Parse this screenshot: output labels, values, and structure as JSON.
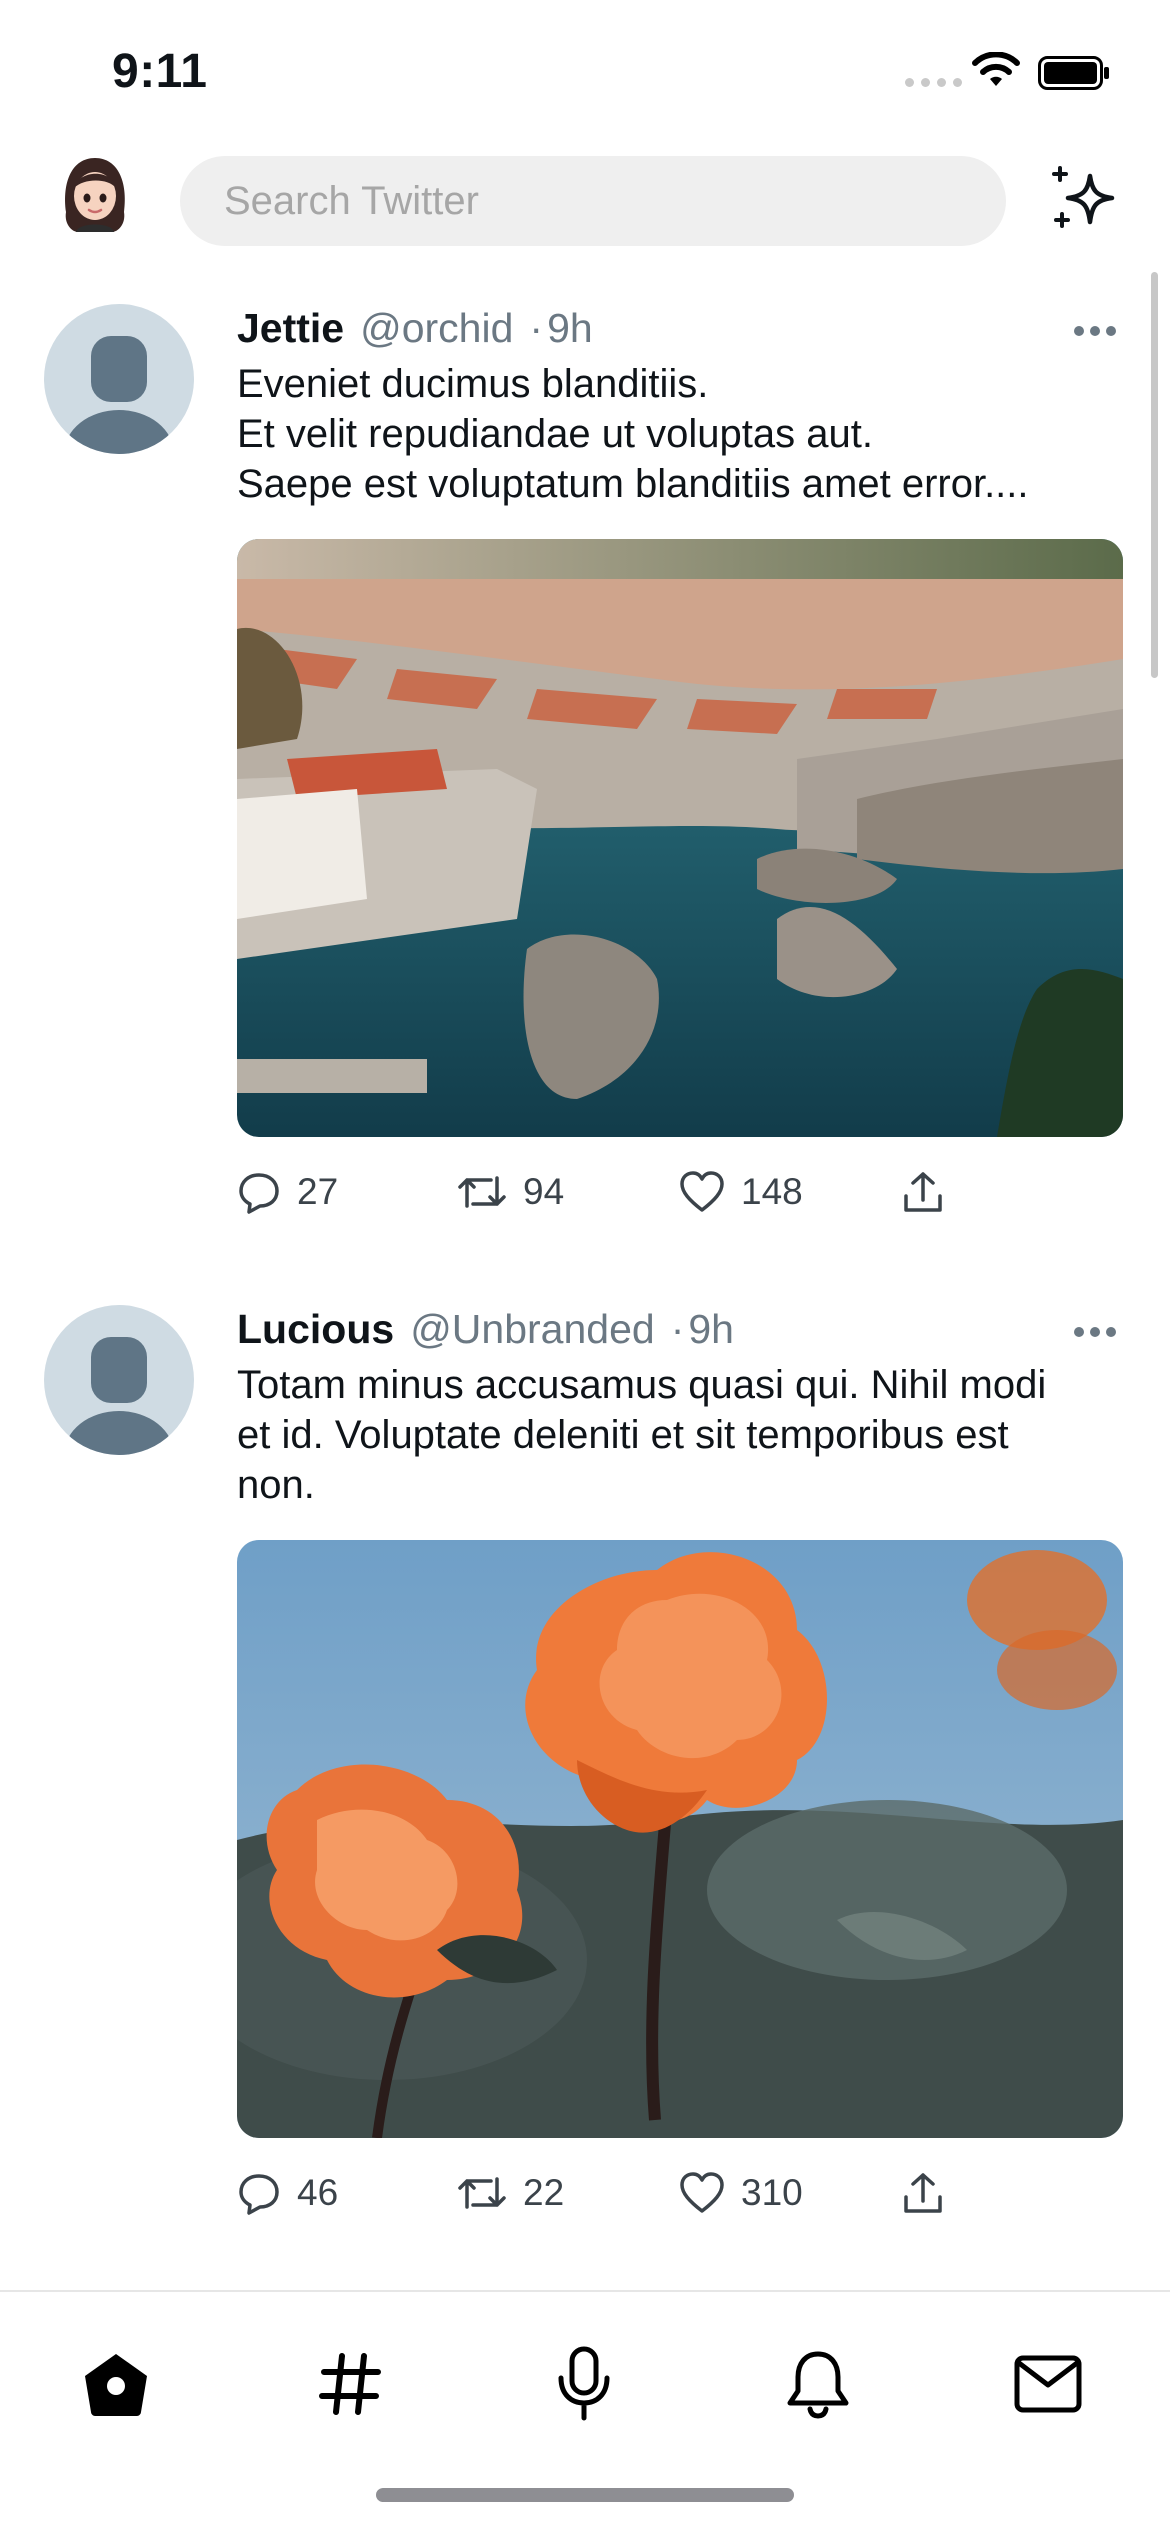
{
  "status_bar": {
    "time": "9:11"
  },
  "header": {
    "search_placeholder": "Search Twitter",
    "profile_icon": "memoji-avatar-icon",
    "sparkle_icon": "sparkle-icon"
  },
  "colors": {
    "text": "#0f1419",
    "muted": "#6b7883",
    "search_bg": "#efefef",
    "avatar_bg": "#cfdbe3",
    "avatar_fg": "#5f7586"
  },
  "tweets": [
    {
      "name": "Jettie",
      "handle": "@orchid",
      "separator": "·",
      "time": "9h",
      "text_lines": [
        "Eveniet ducimus blanditiis.",
        "Et velit repudiandae ut voluptas aut.",
        "Saepe est voluptatum blanditiis amet error...."
      ],
      "media": "coastal-town-photo",
      "replies": "27",
      "retweets": "94",
      "likes": "148"
    },
    {
      "name": "Lucious",
      "handle": "@Unbranded",
      "separator": "·",
      "time": "9h",
      "text_lines": [
        "Totam minus accusamus quasi qui. Nihil modi",
        "et id. Voluptate deleniti et sit temporibus est",
        "non."
      ],
      "media": "orange-roses-photo",
      "replies": "46",
      "retweets": "22",
      "likes": "310"
    }
  ],
  "tab_bar": {
    "tabs": [
      "home-icon",
      "hashtag-icon",
      "microphone-icon",
      "bell-icon",
      "mail-icon"
    ]
  }
}
